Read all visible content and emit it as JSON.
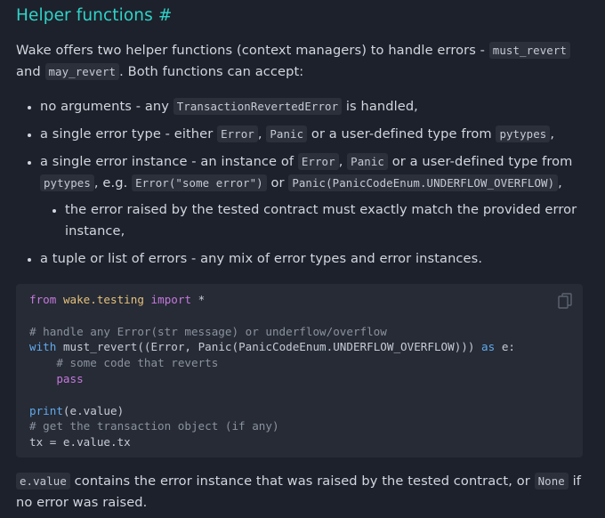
{
  "heading": {
    "title": "Helper functions",
    "anchor": "#"
  },
  "intro": {
    "t1": "Wake offers two helper functions (context managers) to handle errors - ",
    "c1": "must_revert",
    "t2": " and ",
    "c2": "may_revert",
    "t3": ". Both functions can accept:"
  },
  "bullets": {
    "b1": {
      "t1": "no arguments - any ",
      "c1": "TransactionRevertedError",
      "t2": " is handled,"
    },
    "b2": {
      "t1": "a single error type - either ",
      "c1": "Error",
      "t2": ", ",
      "c2": "Panic",
      "t3": " or a user-defined type from ",
      "c3": "pytypes",
      "t4": ","
    },
    "b3": {
      "t1": "a single error instance - an instance of ",
      "c1": "Error",
      "t2": ", ",
      "c2": "Panic",
      "t3": " or a user-defined type from ",
      "c3": "pytypes",
      "t4": ", e.g. ",
      "c4": "Error(\"some error\")",
      "t5": " or ",
      "c5": "Panic(PanicCodeEnum.UNDERFLOW_OVERFLOW)",
      "t6": ",",
      "sub": "the error raised by the tested contract must exactly match the provided error instance,"
    },
    "b4": {
      "t1": "a tuple or list of errors - any mix of error types and error instances."
    }
  },
  "code": {
    "l1_kw": "from",
    "l1_mod": "wake.testing",
    "l1_kw2": "import",
    "l1_rest": "*",
    "l3": "# handle any Error(str message) or underflow/overflow",
    "l4_kw": "with",
    "l4_mid": "must_revert((Error, Panic(PanicCodeEnum.UNDERFLOW_OVERFLOW)))",
    "l4_kw2": "as",
    "l4_end": "e:",
    "l5": "# some code that reverts",
    "l6": "pass",
    "l8_bi": "print",
    "l8_rest": "(e.value)",
    "l9": "# get the transaction object (if any)",
    "l10": "tx = e.value.tx"
  },
  "copy_icon": "copy-icon",
  "outro": {
    "c1": "e.value",
    "t1": " contains the error instance that was raised by the tested contract, or ",
    "c2": "None",
    "t2": " if no error was raised."
  }
}
